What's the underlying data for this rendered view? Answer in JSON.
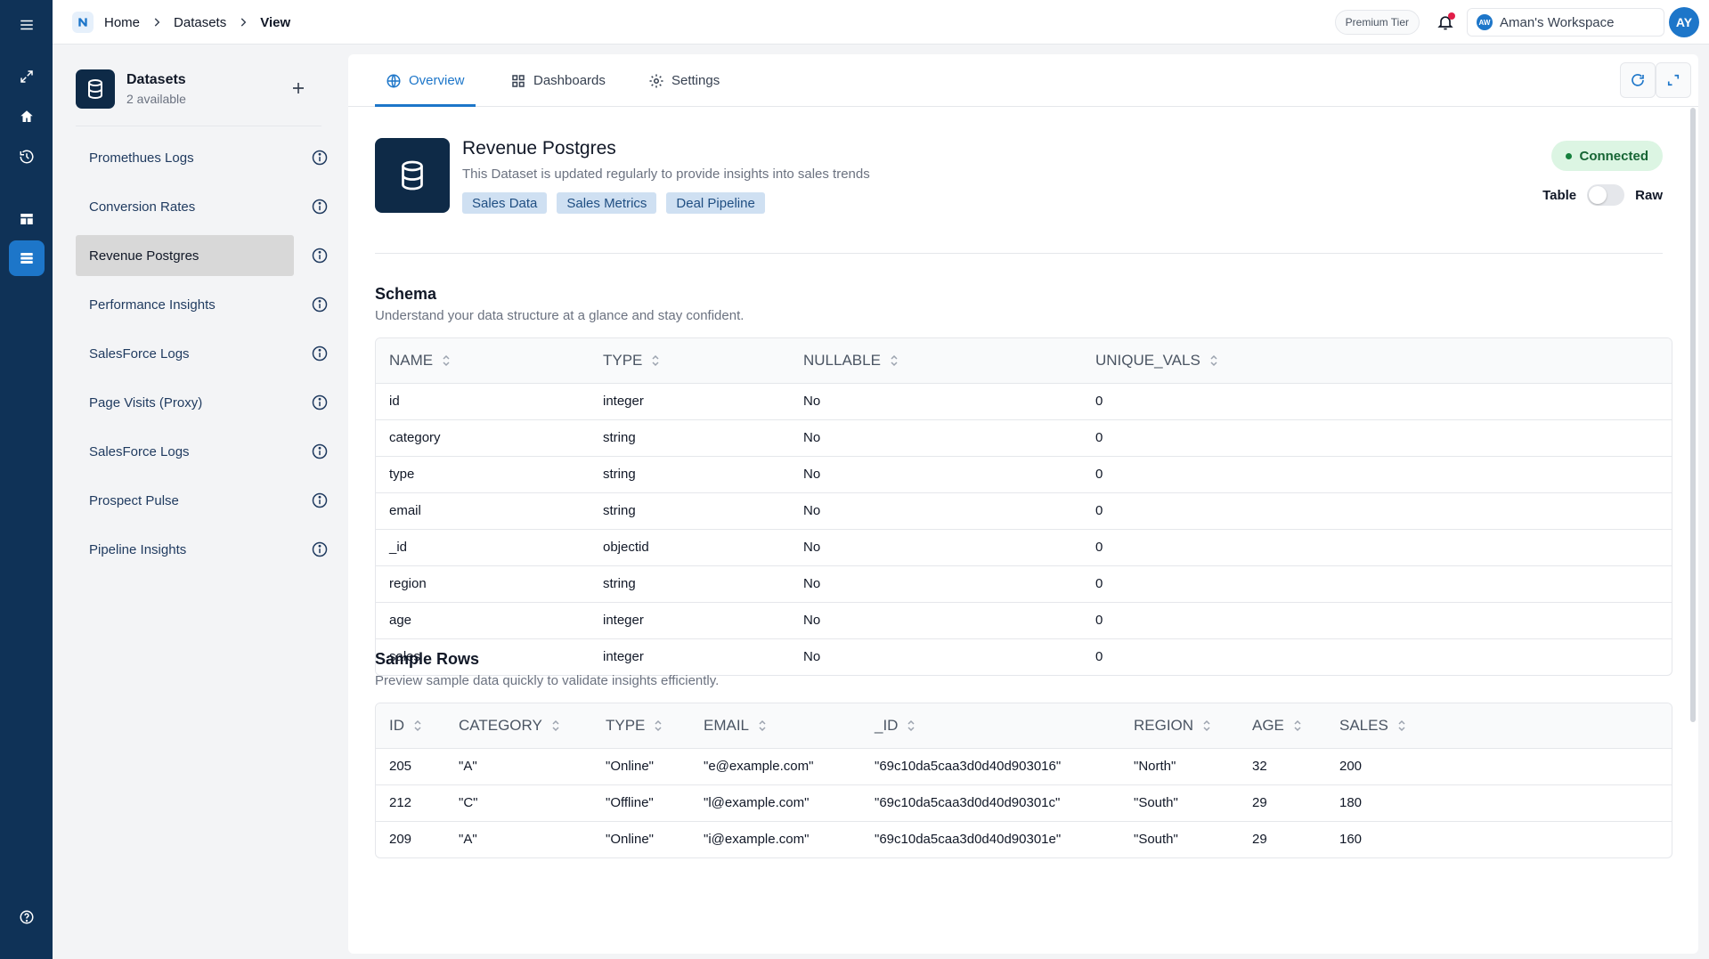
{
  "breadcrumb": [
    "Home",
    "Datasets",
    "View"
  ],
  "topbar": {
    "tier": "Premium Tier",
    "workspace_initials": "AW",
    "workspace_name": "Aman's Workspace",
    "user_initials": "AY"
  },
  "datasets_panel": {
    "title": "Datasets",
    "subtitle": "2 available",
    "items": [
      {
        "label": "Promethues Logs",
        "active": false
      },
      {
        "label": "Conversion Rates",
        "active": false
      },
      {
        "label": "Revenue Postgres",
        "active": true
      },
      {
        "label": "Performance Insights",
        "active": false
      },
      {
        "label": "SalesForce Logs",
        "active": false
      },
      {
        "label": "Page Visits (Proxy)",
        "active": false
      },
      {
        "label": "SalesForce Logs",
        "active": false
      },
      {
        "label": "Prospect Pulse",
        "active": false
      },
      {
        "label": "Pipeline Insights",
        "active": false
      }
    ]
  },
  "tabs": [
    {
      "label": "Overview",
      "icon": "globe-icon",
      "active": true
    },
    {
      "label": "Dashboards",
      "icon": "grid-icon",
      "active": false
    },
    {
      "label": "Settings",
      "icon": "gear-icon",
      "active": false
    }
  ],
  "dataset": {
    "title": "Revenue Postgres",
    "description": "This Dataset is updated regularly to provide insights into sales trends",
    "tags": [
      "Sales Data",
      "Sales Metrics",
      "Deal Pipeline"
    ],
    "status": "Connected",
    "view_toggle": {
      "left": "Table",
      "right": "Raw",
      "state": "Table"
    }
  },
  "schema": {
    "title": "Schema",
    "subtitle": "Understand your data structure at a glance and stay confident.",
    "columns": [
      "NAME",
      "TYPE",
      "NULLABLE",
      "UNIQUE_VALS"
    ],
    "rows": [
      [
        "id",
        "integer",
        "No",
        "0"
      ],
      [
        "category",
        "string",
        "No",
        "0"
      ],
      [
        "type",
        "string",
        "No",
        "0"
      ],
      [
        "email",
        "string",
        "No",
        "0"
      ],
      [
        "_id",
        "objectid",
        "No",
        "0"
      ],
      [
        "region",
        "string",
        "No",
        "0"
      ],
      [
        "age",
        "integer",
        "No",
        "0"
      ],
      [
        "sales",
        "integer",
        "No",
        "0"
      ]
    ]
  },
  "sample": {
    "title": "Sample Rows",
    "subtitle": "Preview sample data quickly to validate insights efficiently.",
    "columns": [
      "ID",
      "CATEGORY",
      "TYPE",
      "EMAIL",
      "_ID",
      "REGION",
      "AGE",
      "SALES"
    ],
    "rows": [
      [
        "205",
        "\"A\"",
        "\"Online\"",
        "\"e@example.com\"",
        "\"69c10da5caa3d0d40d903016\"",
        "\"North\"",
        "32",
        "200"
      ],
      [
        "212",
        "\"C\"",
        "\"Offline\"",
        "\"l@example.com\"",
        "\"69c10da5caa3d0d40d90301c\"",
        "\"South\"",
        "29",
        "180"
      ],
      [
        "209",
        "\"A\"",
        "\"Online\"",
        "\"i@example.com\"",
        "\"69c10da5caa3d0d40d90301e\"",
        "\"South\"",
        "29",
        "160"
      ]
    ]
  },
  "colors": {
    "rail": "#0f3257",
    "accent": "#1d76c9",
    "status_bg": "#dcf5e3",
    "status_text": "#166534",
    "tag_bg": "#cfe0f2"
  }
}
